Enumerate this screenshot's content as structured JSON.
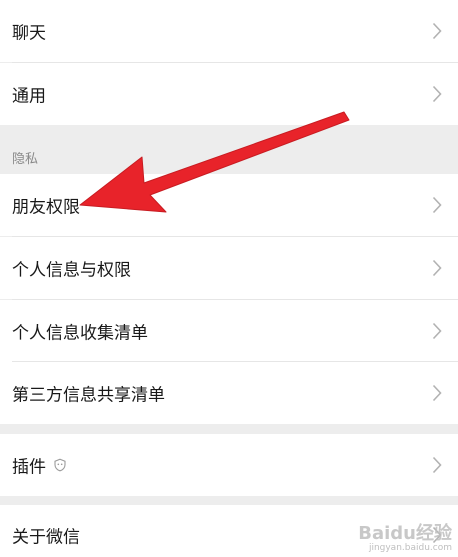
{
  "rows_top": [
    {
      "label": "聊天"
    },
    {
      "label": "通用"
    }
  ],
  "privacy": {
    "section_label": "隐私",
    "items": [
      {
        "label": "朋友权限"
      },
      {
        "label": "个人信息与权限"
      },
      {
        "label": "个人信息收集清单"
      },
      {
        "label": "第三方信息共享清单"
      }
    ]
  },
  "plugin": {
    "label": "插件"
  },
  "about": {
    "label": "关于微信"
  },
  "watermark": {
    "text": "Baidu经验",
    "sub": "jingyan.baidu.com"
  },
  "colors": {
    "annotation_arrow": "#e8232a",
    "background": "#ededed",
    "row": "#ffffff"
  }
}
